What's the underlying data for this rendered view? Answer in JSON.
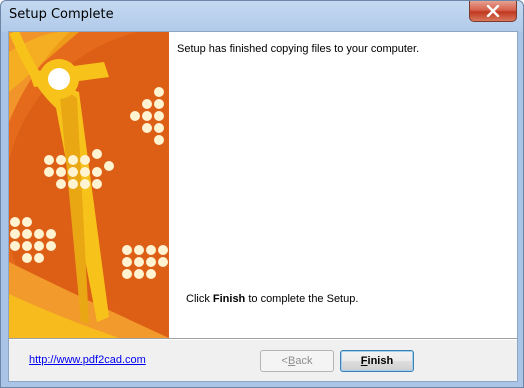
{
  "window": {
    "title": "Setup Complete"
  },
  "icons": {
    "close": "close-icon"
  },
  "main": {
    "message_top": "Setup has finished copying files to your computer.",
    "message_bottom_prefix": "Click ",
    "message_bottom_bold": "Finish",
    "message_bottom_suffix": " to complete the Setup."
  },
  "footer": {
    "link_text": "http://www.pdf2cad.com",
    "back_prefix": "< ",
    "back_accel": "B",
    "back_rest": "ack",
    "finish_accel": "F",
    "finish_rest": "inish"
  },
  "colors": {
    "banner_orange": "#e56a1c",
    "banner_yellow": "#f7c31a",
    "link_blue": "#0000ee"
  }
}
